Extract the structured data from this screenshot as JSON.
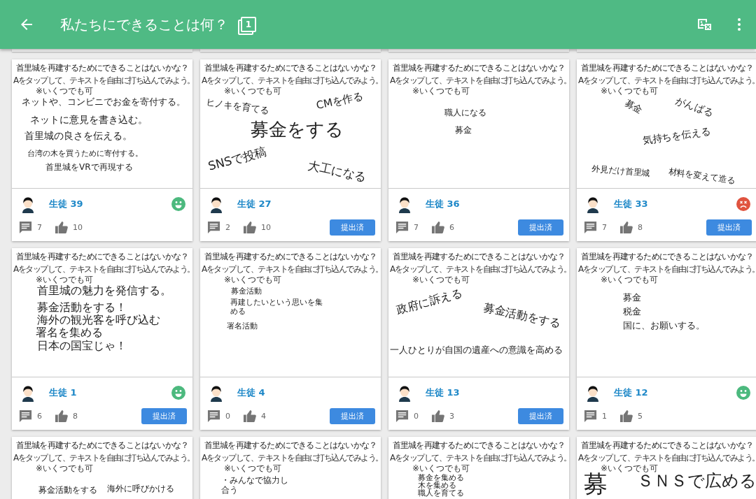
{
  "app_bar": {
    "title": "私たちにできることは何？",
    "page_count": "1"
  },
  "cards": [
    {
      "prompt": "首里城を再建するためにできることはないかな？",
      "instruction": "Aをタップして、テキストを自由に打ち込んでみよう。",
      "note": "※いくつでも可",
      "answers": [
        {
          "text": "ネットや、コンビニでお金を寄付する。"
        },
        {
          "text": "ネットに意見を書き込む。"
        },
        {
          "text": "首里城の良さを伝える。"
        },
        {
          "text": "台湾の木を買うために寄付する。"
        },
        {
          "text": "首里城をVRで再現する"
        }
      ],
      "student": "生徒 39",
      "reaction": {
        "kind": "happy",
        "color": "#4cb97e"
      },
      "comments": "7",
      "likes": "10"
    },
    {
      "prompt": "首里城を再建するためにできることはないかな？",
      "instruction": "Aをタップして、テキストを自由に打ち込んでみよう。",
      "note": "※いくつでも可",
      "answers": [
        {
          "text": "ヒノキを育てる"
        },
        {
          "text": "CMを作る"
        },
        {
          "text": "募金をする"
        },
        {
          "text": "SNSで投稿"
        },
        {
          "text": "大工になる"
        }
      ],
      "student": "生徒 27",
      "comments": "2",
      "likes": "10",
      "submitted_label": "提出済"
    },
    {
      "prompt": "首里城を再建するためにできることはないかな？",
      "instruction": "Aをタップして、テキストを自由に打ち込んでみよう。",
      "note": "※いくつでも可",
      "answers": [
        {
          "text": "職人になる"
        },
        {
          "text": "募金"
        }
      ],
      "student": "生徒 36",
      "comments": "7",
      "likes": "6",
      "submitted_label": "提出済"
    },
    {
      "prompt": "首里城を再建するためにできることはないかな？",
      "instruction": "Aをタップして、テキストを自由に打ち込んでみよう。",
      "note": "※いくつでも可",
      "answers": [
        {
          "text": "募金"
        },
        {
          "text": "がんばる"
        },
        {
          "text": "気持ちを伝える"
        },
        {
          "text": "外見だけ首里城"
        },
        {
          "text": "材料を変えて造る"
        }
      ],
      "student": "生徒 33",
      "reaction": {
        "kind": "sad",
        "color": "#e0533f"
      },
      "comments": "7",
      "likes": "8",
      "submitted_label": "提出済"
    },
    {
      "prompt": "首里城を再建するためにできることはないかな？",
      "instruction": "Aをタップして、テキストを自由に打ち込んでみよう。",
      "note": "※いくつでも可",
      "answers": [
        {
          "text": "首里城の魅力を発信する。"
        },
        {
          "text": "募金活動をする！"
        },
        {
          "text": "海外の観光客を呼び込む"
        },
        {
          "text": "署名を集める"
        },
        {
          "text": "日本の国宝じゃ！"
        }
      ],
      "student": "生徒 1",
      "reaction": {
        "kind": "happy",
        "color": "#4cb97e"
      },
      "comments": "6",
      "likes": "8",
      "submitted_label": "提出済"
    },
    {
      "prompt": "首里城を再建するためにできることはないかな？",
      "instruction": "Aをタップして、テキストを自由に打ち込んでみよう。",
      "note": "※いくつでも可",
      "answers": [
        {
          "text": "募金活動"
        },
        {
          "text": "再建したいという思いを集める"
        },
        {
          "text": "署名活動"
        }
      ],
      "student": "生徒 4",
      "comments": "0",
      "likes": "4",
      "submitted_label": "提出済"
    },
    {
      "prompt": "首里城を再建するためにできることはないかな？",
      "instruction": "Aをタップして、テキストを自由に打ち込んでみよう。",
      "note": "※いくつでも可",
      "answers": [
        {
          "text": "政府に訴える"
        },
        {
          "text": "募金活動をする"
        },
        {
          "text": "一人ひとりが自国の遺産への意識を高める"
        }
      ],
      "student": "生徒 13",
      "comments": "0",
      "likes": "3",
      "submitted_label": "提出済"
    },
    {
      "prompt": "首里城を再建するためにできることはないかな？",
      "instruction": "Aをタップして、テキストを自由に打ち込んでみよう。",
      "note": "※いくつでも可",
      "answers": [
        {
          "text": "募金"
        },
        {
          "text": "税金"
        },
        {
          "text": "国に、お願いする。"
        }
      ],
      "student": "生徒 12",
      "reaction": {
        "kind": "happy",
        "color": "#4cb97e"
      },
      "comments": "1",
      "likes": "5"
    },
    {
      "prompt": "首里城を再建するためにできることはないかな？",
      "instruction": "Aをタップして、テキストを自由に打ち込んでみよう。",
      "note": "※いくつでも可",
      "answers": [
        {
          "text": "募金活動をする"
        },
        {
          "text": "海外に呼びかける"
        }
      ]
    },
    {
      "prompt": "首里城を再建するためにできることはないかな？",
      "instruction": "Aをタップして、テキストを自由に打ち込んでみよう。",
      "note": "※いくつでも可",
      "answers": [
        {
          "text": "・みんなで協力し合う"
        }
      ]
    },
    {
      "prompt": "首里城を再建するためにできることはないかな？",
      "instruction": "Aをタップして、テキストを自由に打ち込んでみよう。",
      "note": "※いくつでも可",
      "answers": [
        {
          "text": "募金を集める"
        },
        {
          "text": "木を集める"
        },
        {
          "text": "職人を育てる"
        }
      ]
    },
    {
      "prompt": "首里城を再建するためにできることはないかな？",
      "instruction": "Aをタップして、テキストを自由に打ち込んでみよう。",
      "note": "※いくつでも可",
      "answers": [
        {
          "text": "募"
        },
        {
          "text": "ＳＮＳで広める"
        }
      ]
    }
  ]
}
